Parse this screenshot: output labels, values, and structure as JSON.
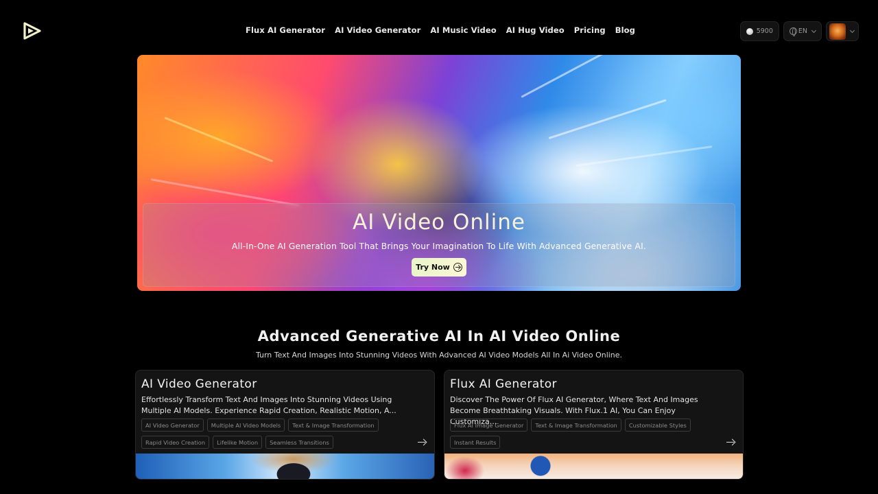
{
  "header": {
    "nav": [
      "Flux AI Generator",
      "AI Video Generator",
      "AI Music Video",
      "AI Hug Video",
      "Pricing",
      "Blog"
    ],
    "credits": "5900",
    "language": "EN"
  },
  "hero": {
    "title": "AI Video Online",
    "subtitle": "All-In-One AI Generation Tool That Brings Your Imagination To Life With Advanced Generative AI.",
    "cta": "Try Now"
  },
  "section": {
    "title": "Advanced Generative AI In AI Video Online",
    "subtitle": "Turn Text And Images Into Stunning Videos With Advanced AI Video Models All In Ai Video Online."
  },
  "cards": [
    {
      "title": "AI Video Generator",
      "desc1": "Effortlessly Transform Text And Images Into Stunning Videos Using",
      "desc2": "Multiple AI Models. Experience Rapid Creation, Realistic Motion, A...",
      "tags": [
        "AI Video Generator",
        "Multiple AI Video Models",
        "Text & Image Transformation",
        "Rapid Video Creation",
        "Lifelike Motion",
        "Seamless Transitions"
      ]
    },
    {
      "title": "Flux AI Generator",
      "desc1": "Discover The Power Of Flux AI Generator, Where Text And Images",
      "desc2": "Become Breathtaking Visuals. With Flux.1 AI, You Can Enjoy Customiza...",
      "tags": [
        "Flux AI Image Generator",
        "Text & Image Transformation",
        "Customizable Styles",
        "Instant Results"
      ]
    }
  ],
  "colors": {
    "background": "#000000",
    "cta": "#eef6d2",
    "card": "#141414"
  }
}
